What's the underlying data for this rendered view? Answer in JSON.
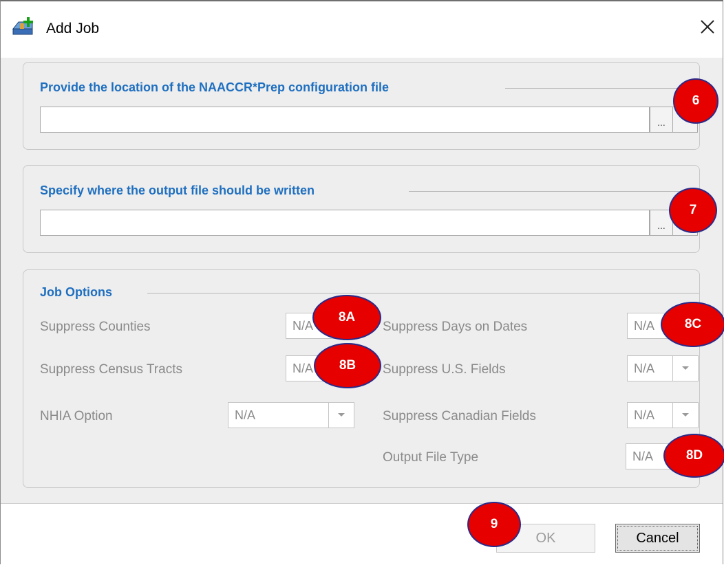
{
  "window": {
    "title": "Add Job"
  },
  "config_panel": {
    "title": "Provide the location of the NAACCR*Prep configuration file",
    "path_value": "",
    "browse_label": "...",
    "badge": "6"
  },
  "output_panel": {
    "title": "Specify where the output file should be written",
    "path_value": "",
    "browse_label": "...",
    "badge": "7"
  },
  "job_options": {
    "title": "Job Options",
    "suppress_counties": {
      "label": "Suppress Counties",
      "value": "N/A",
      "badge": "8A"
    },
    "suppress_census_tracts": {
      "label": "Suppress Census Tracts",
      "value": "N/A",
      "badge": "8B"
    },
    "nhia_option": {
      "label": "NHIA Option",
      "value": "N/A"
    },
    "suppress_days_on_dates": {
      "label": "Suppress Days on Dates",
      "value": "N/A",
      "badge": "8C"
    },
    "suppress_us_fields": {
      "label": "Suppress U.S. Fields",
      "value": "N/A"
    },
    "suppress_canadian_fields": {
      "label": "Suppress Canadian Fields",
      "value": "N/A"
    },
    "output_file_type": {
      "label": "Output File Type",
      "value": "N/A",
      "badge": "8D"
    }
  },
  "footer": {
    "ok_label": "OK",
    "cancel_label": "Cancel",
    "badge": "9"
  },
  "colors": {
    "section_title": "#1f6fc0",
    "badge_fill": "#e60000",
    "badge_border": "#2a2a8a",
    "disabled_text": "#8a8a8a"
  },
  "icons": {
    "app": "add-job-icon",
    "close": "close-icon",
    "dropdown": "chevron-down-icon"
  }
}
